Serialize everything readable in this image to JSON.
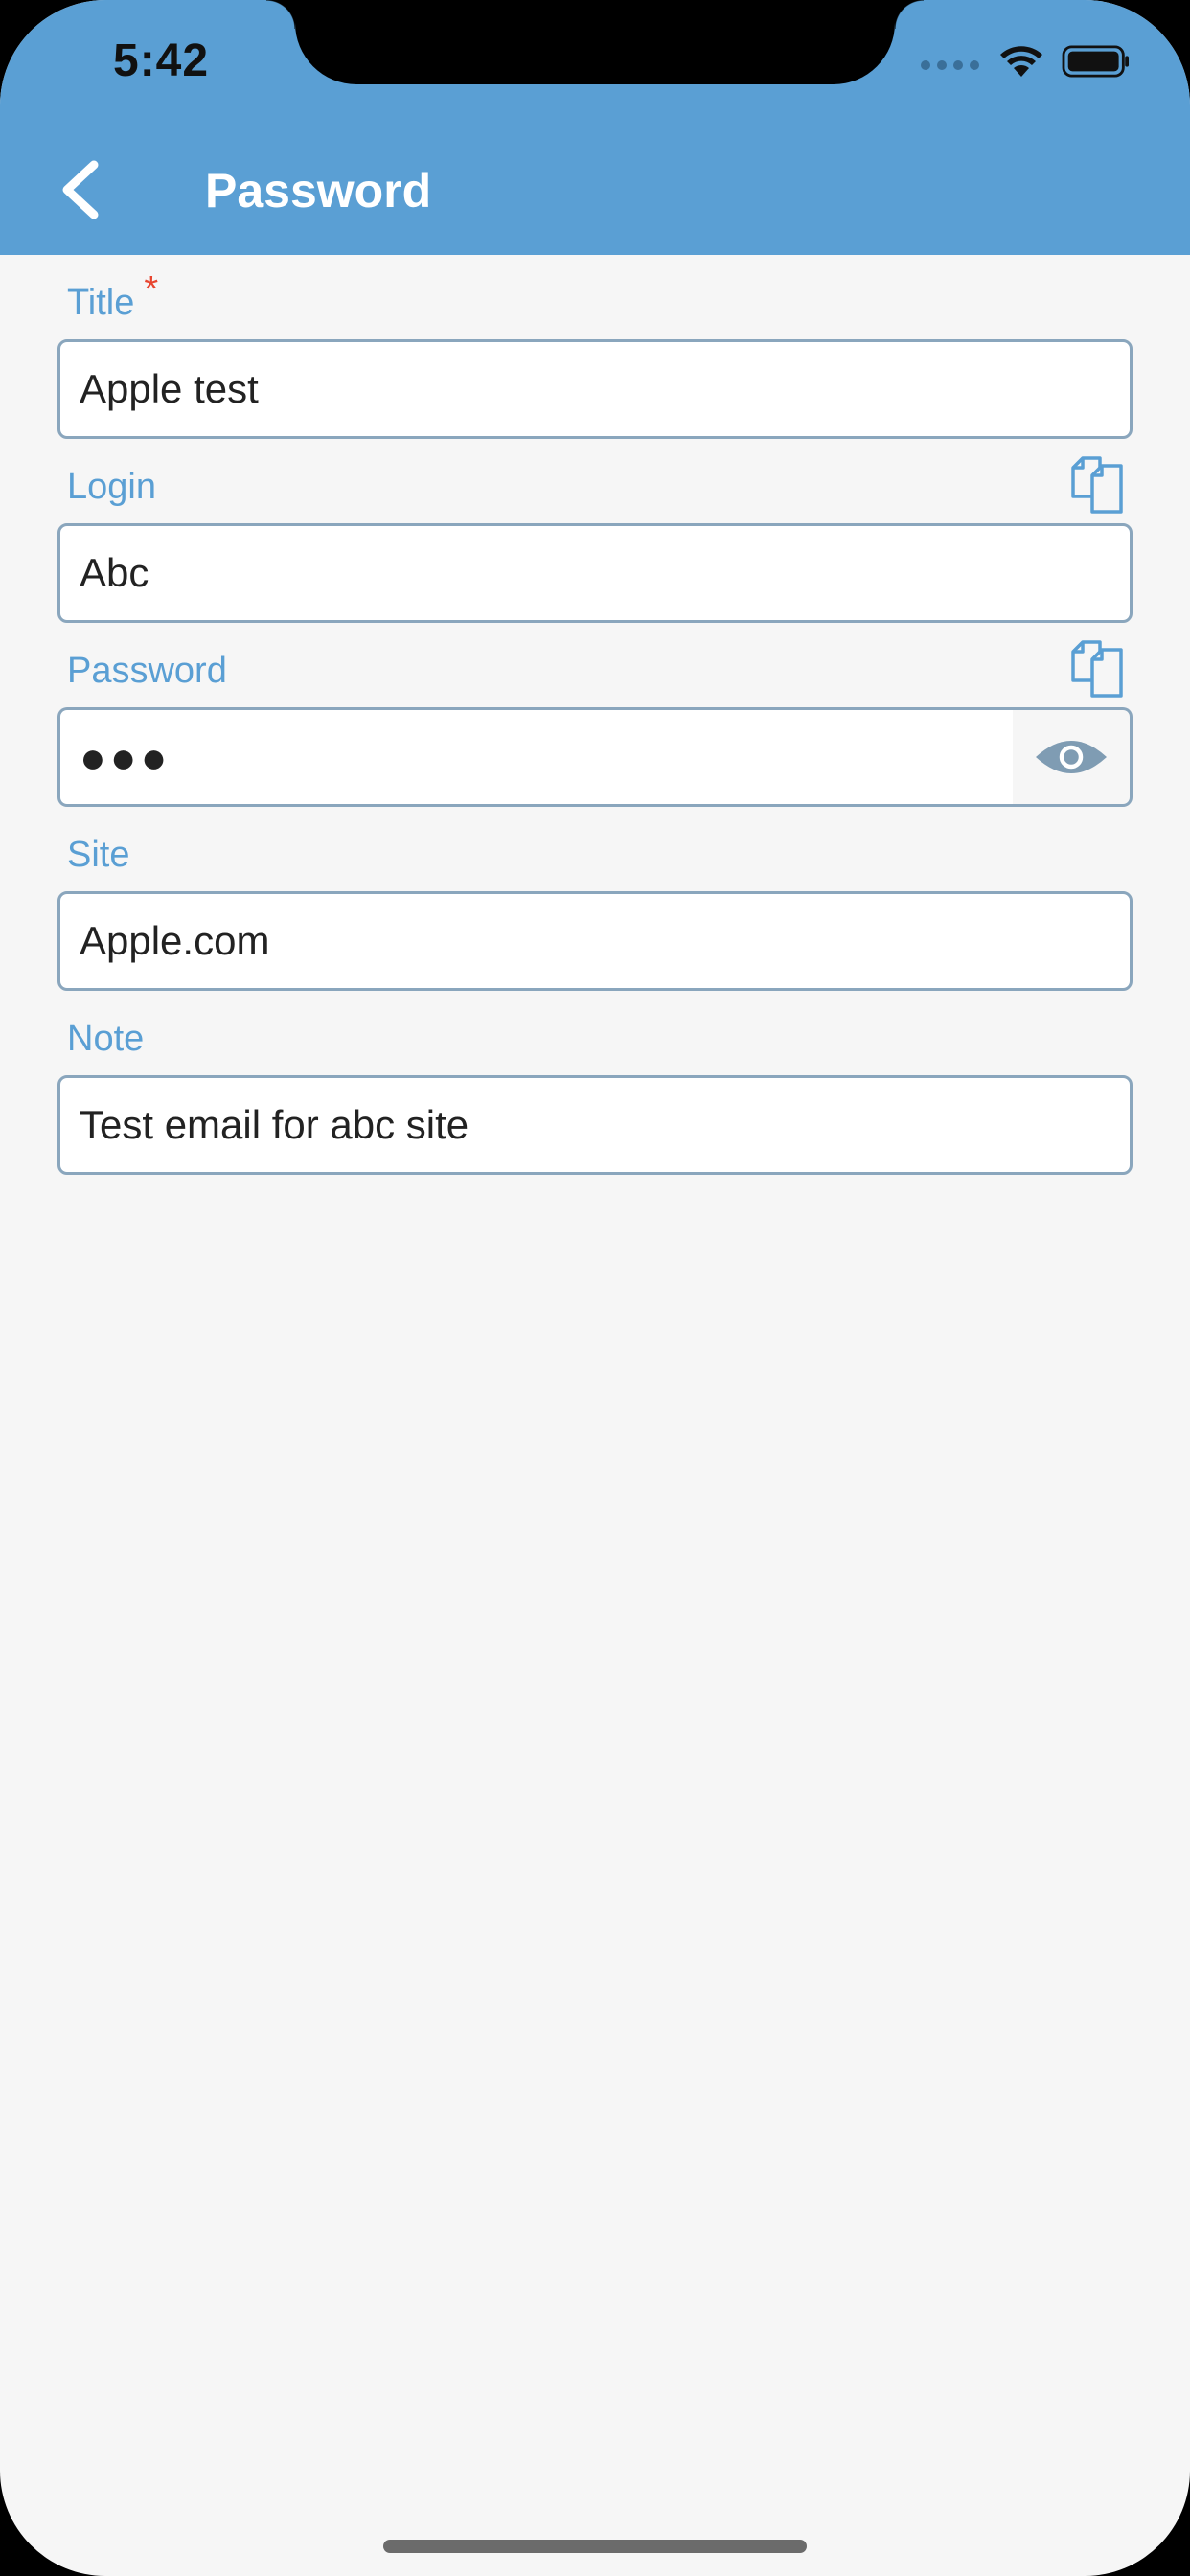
{
  "status_bar": {
    "time": "5:42"
  },
  "nav": {
    "title": "Password",
    "back_icon": "chevron-left-icon"
  },
  "form": {
    "title": {
      "label": "Title",
      "required_mark": "*",
      "value": "Apple test"
    },
    "login": {
      "label": "Login",
      "value": "Abc",
      "copy_icon": "copy-icon"
    },
    "password": {
      "label": "Password",
      "value": "●●●",
      "copy_icon": "copy-icon",
      "toggle_icon": "eye-icon"
    },
    "site": {
      "label": "Site",
      "value": "Apple.com"
    },
    "note": {
      "label": "Note",
      "value": "Test email for abc site"
    }
  },
  "colors": {
    "accent": "#5a9fd4",
    "required": "#e8452f",
    "border": "#8aa6bd",
    "background": "#f6f6f6"
  }
}
